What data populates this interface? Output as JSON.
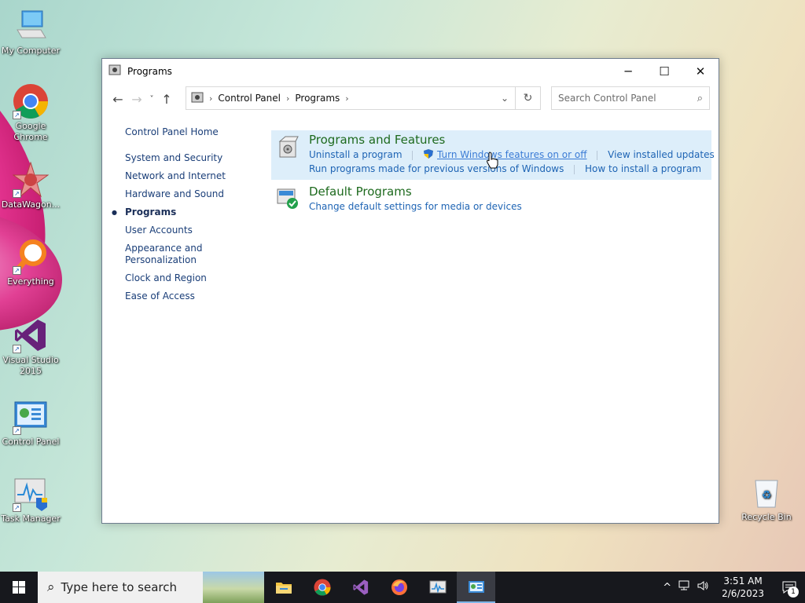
{
  "desktop": {
    "icons": [
      {
        "label": "My Computer",
        "icon": "computer-icon"
      },
      {
        "label": "Google Chrome",
        "icon": "chrome-icon"
      },
      {
        "label": "DataWagon...",
        "icon": "datawagon-icon"
      },
      {
        "label": "Everything",
        "icon": "everything-search-icon"
      },
      {
        "label": "Visual Studio 2015",
        "icon": "visual-studio-icon"
      },
      {
        "label": "Control Panel",
        "icon": "control-panel-icon"
      },
      {
        "label": "Task Manager",
        "icon": "task-manager-icon"
      },
      {
        "label": "Recycle Bin",
        "icon": "recycle-bin-icon"
      }
    ]
  },
  "window": {
    "title": "Programs",
    "controls": {
      "minimize": "─",
      "maximize": "☐",
      "close": "✕"
    },
    "breadcrumb": [
      "Control Panel",
      "Programs"
    ],
    "search_placeholder": "Search Control Panel",
    "left_nav": {
      "home": "Control Panel Home",
      "items": [
        "System and Security",
        "Network and Internet",
        "Hardware and Sound",
        "Programs",
        "User Accounts",
        "Appearance and Personalization",
        "Clock and Region",
        "Ease of Access"
      ],
      "active_index": 3
    },
    "categories": [
      {
        "title": "Programs and Features",
        "links": [
          "Uninstall a program",
          "Turn Windows features on or off",
          "View installed updates",
          "Run programs made for previous versions of Windows",
          "How to install a program"
        ]
      },
      {
        "title": "Default Programs",
        "links": [
          "Change default settings for media or devices"
        ]
      }
    ]
  },
  "taskbar": {
    "search_placeholder": "Type here to search",
    "apps": [
      "file-explorer-icon",
      "chrome-icon",
      "visual-studio-icon",
      "firefox-icon",
      "task-manager-icon",
      "control-panel-icon"
    ],
    "active_app": "control-panel-icon",
    "clock_time": "3:51 AM",
    "clock_date": "2/6/2023",
    "notification_count": "1"
  }
}
